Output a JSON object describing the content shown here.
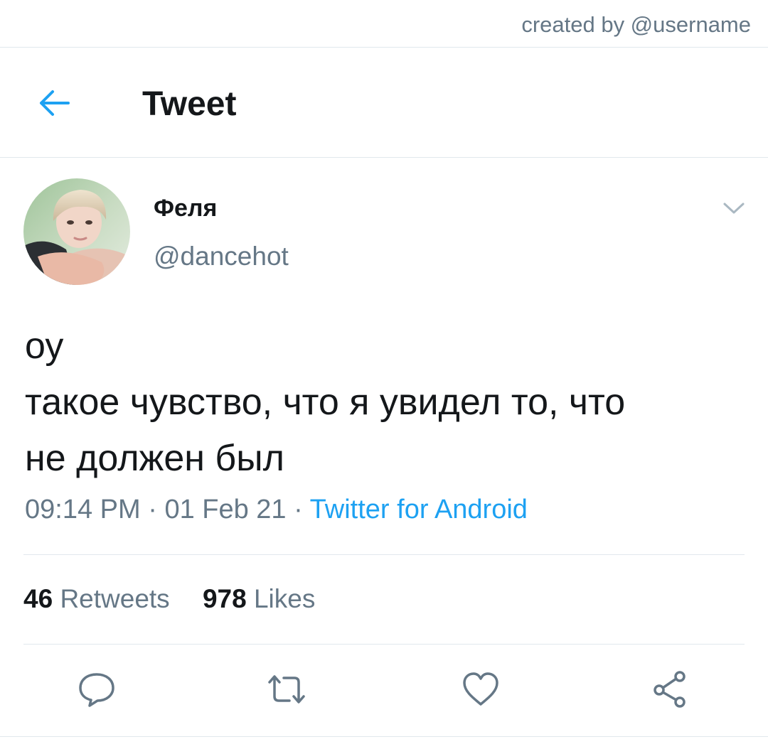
{
  "credit": "created by @username",
  "header": {
    "title": "Tweet",
    "back_icon": "arrow-left-icon"
  },
  "tweet": {
    "author": {
      "display_name": "Феля",
      "handle": "@dancehot"
    },
    "text_lines": [
      "оу",
      "такое чувство, что я увидел то, что",
      "не должен был"
    ],
    "time": "09:14 PM",
    "date": "01 Feb 21",
    "separator": "·",
    "source": "Twitter for Android"
  },
  "stats": {
    "retweets_count": "46",
    "retweets_label": "Retweets",
    "likes_count": "978",
    "likes_label": "Likes"
  },
  "actions": [
    "reply-icon",
    "retweet-icon",
    "like-icon",
    "share-icon"
  ],
  "colors": {
    "accent": "#1da1f2",
    "secondary_text": "#657786",
    "icon_gray": "#657786",
    "divider": "#e1e8ed"
  }
}
